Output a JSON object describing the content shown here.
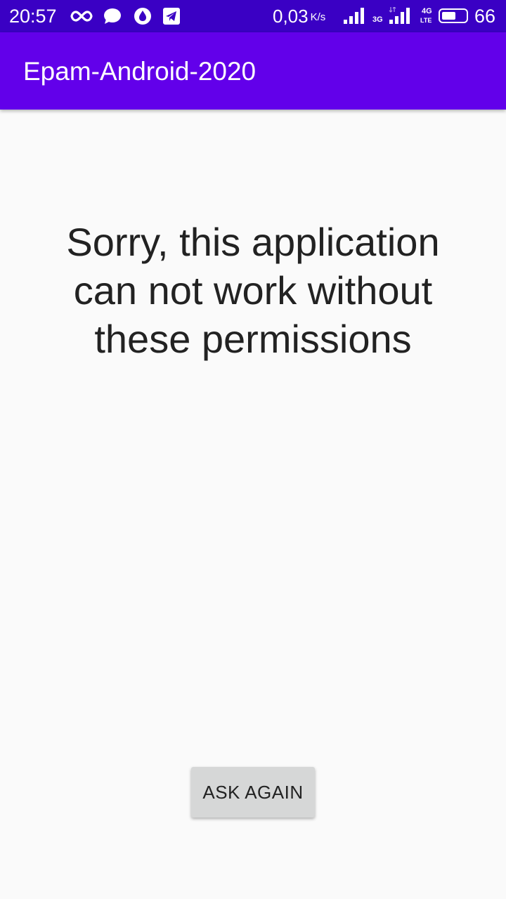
{
  "status_bar": {
    "time": "20:57",
    "notification_icons": [
      "infinity-icon",
      "chat-bubble-icon",
      "water-drop-icon",
      "telegram-icon"
    ],
    "net_speed": "0,03",
    "net_speed_unit": "K/s",
    "network_type_1": "3G",
    "network_type_2_top": "4G",
    "network_type_2_bottom": "LTE",
    "battery_level": "66",
    "battery_fraction": 0.66
  },
  "app_bar": {
    "title": "Epam-Android-2020",
    "color": "#6200ea"
  },
  "main": {
    "message": "Sorry, this application can not work without these permissions",
    "ask_again_label": "ASK AGAIN"
  },
  "colors": {
    "status_bar": "#3a00c4",
    "background": "#fafafa",
    "button": "#d6d7d7"
  }
}
